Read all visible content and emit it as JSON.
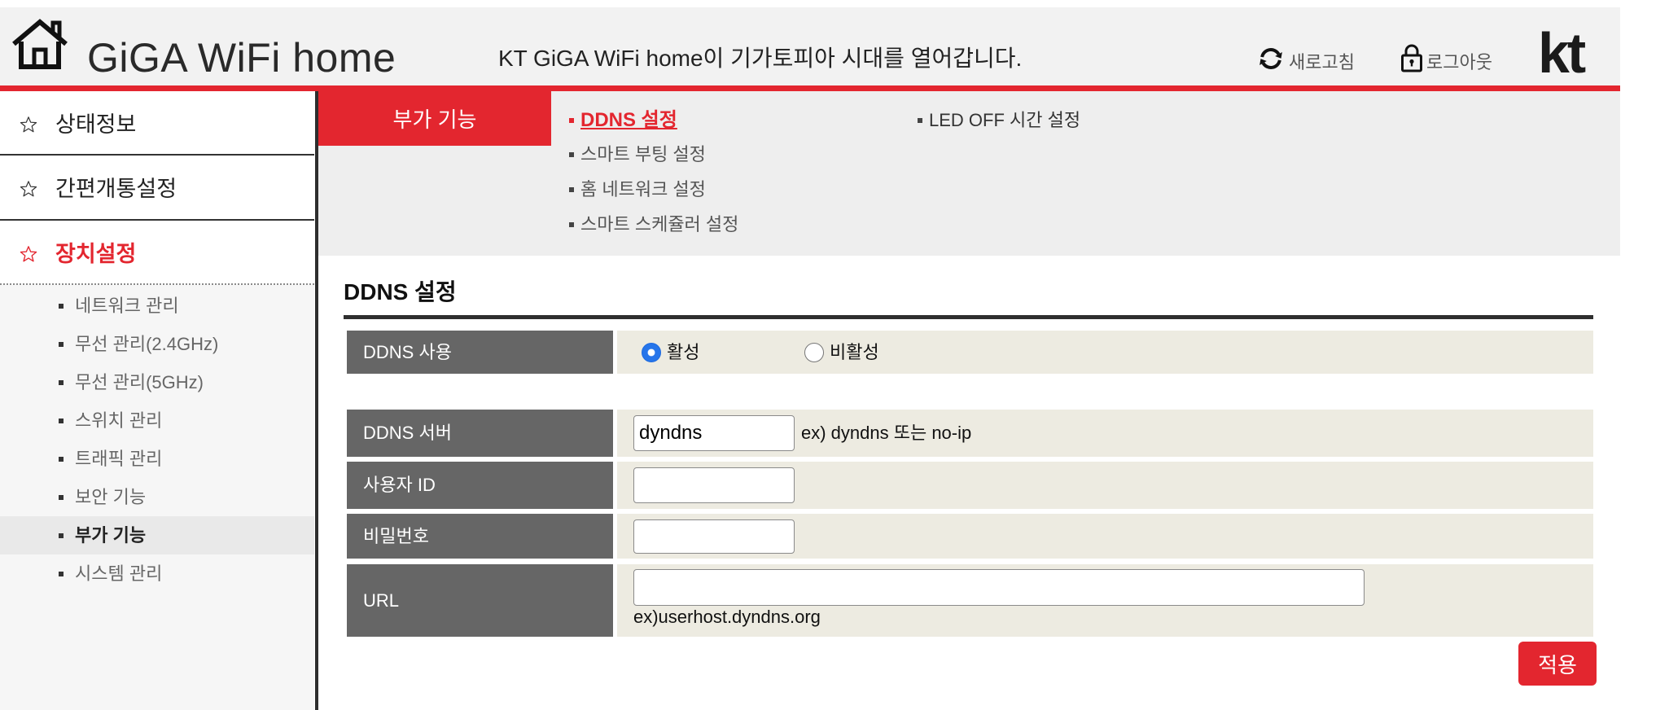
{
  "header": {
    "logo_text": "GiGA WiFi home",
    "tagline": "KT GiGA WiFi home이 기가토피아 시대를 열어갑니다.",
    "refresh_label": "새로고침",
    "logout_label": "로그아웃",
    "brand_logo": "kt",
    "icons": {
      "home": "house-icon",
      "refresh": "refresh-icon",
      "logout": "lock-icon"
    }
  },
  "sidebar": {
    "sections": [
      {
        "label": "상태정보",
        "icon": "star-icon",
        "active": false
      },
      {
        "label": "간편개통설정",
        "icon": "star-icon",
        "active": false
      },
      {
        "label": "장치설정",
        "icon": "star-icon",
        "active": true
      }
    ],
    "items": [
      {
        "label": "네트워크 관리",
        "active": false
      },
      {
        "label": "무선 관리(2.4GHz)",
        "active": false
      },
      {
        "label": "무선 관리(5GHz)",
        "active": false
      },
      {
        "label": "스위치 관리",
        "active": false
      },
      {
        "label": "트래픽 관리",
        "active": false
      },
      {
        "label": "보안 기능",
        "active": false
      },
      {
        "label": "부가 기능",
        "active": true
      },
      {
        "label": "시스템 관리",
        "active": false
      }
    ]
  },
  "subnav": {
    "title": "부가 기능",
    "items": [
      {
        "label": "DDNS 설정",
        "active": true
      },
      {
        "label": "스마트 부팅 설정",
        "active": false
      },
      {
        "label": "홈 네트워크 설정",
        "active": false
      },
      {
        "label": "스마트 스케쥴러 설정",
        "active": false
      },
      {
        "label": "LED OFF 시간 설정",
        "active": false
      }
    ]
  },
  "page": {
    "title": "DDNS 설정",
    "form": {
      "ddns_use": {
        "label": "DDNS 사용",
        "options": [
          "활성",
          "비활성"
        ],
        "selected": "활성"
      },
      "server": {
        "label": "DDNS 서버",
        "value": "dyndns",
        "hint": "ex) dyndns 또는 no-ip"
      },
      "user_id": {
        "label": "사용자 ID",
        "value": ""
      },
      "password": {
        "label": "비밀번호",
        "value": ""
      },
      "url": {
        "label": "URL",
        "value": "",
        "hint": "ex)userhost.dyndns.org"
      }
    },
    "apply_label": "적용"
  },
  "colors": {
    "brand_red": "#e3262f",
    "header_bg": "#f2f2f2",
    "subnav_bg": "#eeeeee",
    "label_bg": "#666666",
    "value_bg": "#edebe1",
    "radio_selected": "#2675ea"
  }
}
